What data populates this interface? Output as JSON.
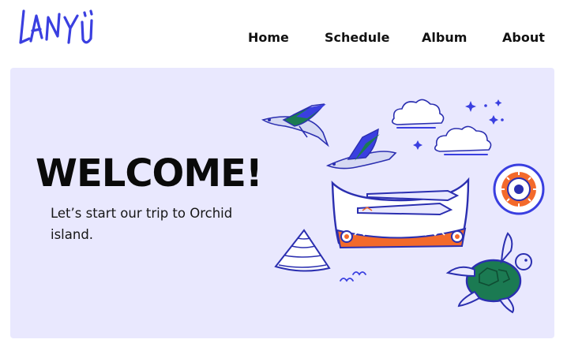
{
  "brand": {
    "logo_text": "LANYU"
  },
  "nav": {
    "items": [
      {
        "label": "Home"
      },
      {
        "label": "Schedule"
      },
      {
        "label": "Album"
      },
      {
        "label": "About"
      }
    ]
  },
  "hero": {
    "title": "WELCOME!",
    "subtitle": "Let’s start our trip to Orchid island."
  },
  "colors": {
    "brand": "#3a3fe0",
    "accent": "#f36a2b",
    "green": "#1b7a52",
    "hero_bg": "#e9e8fe",
    "text": "#111111"
  }
}
